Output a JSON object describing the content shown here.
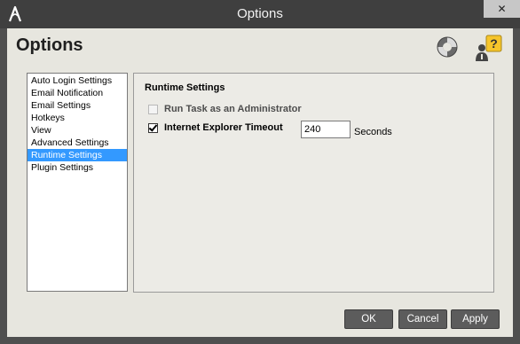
{
  "window": {
    "title": "Options",
    "close_label": "✕"
  },
  "header": {
    "title": "Options",
    "icons": [
      "lifebuoy-icon",
      "help-person-icon"
    ]
  },
  "nav": {
    "items": [
      {
        "label": "Auto Login Settings",
        "selected": false
      },
      {
        "label": "Email Notification",
        "selected": false
      },
      {
        "label": "Email Settings",
        "selected": false
      },
      {
        "label": "Hotkeys",
        "selected": false
      },
      {
        "label": "View",
        "selected": false
      },
      {
        "label": "Advanced Settings",
        "selected": false
      },
      {
        "label": "Runtime Settings",
        "selected": true
      },
      {
        "label": "Plugin Settings",
        "selected": false
      }
    ]
  },
  "panel": {
    "section_title": "Runtime Settings",
    "run_admin": {
      "label": "Run Task as an Administrator",
      "checked": false,
      "enabled": false
    },
    "ie_timeout": {
      "label": "Internet Explorer Timeout",
      "checked": true,
      "enabled": true
    },
    "timeout_value": "240",
    "timeout_unit": "Seconds"
  },
  "buttons": {
    "ok": "OK",
    "cancel": "Cancel",
    "apply": "Apply"
  },
  "colors": {
    "titlebar": "#3f3f3f",
    "window_bg": "#e7e6df",
    "selection": "#3399ff",
    "button": "#5c5c5c"
  }
}
